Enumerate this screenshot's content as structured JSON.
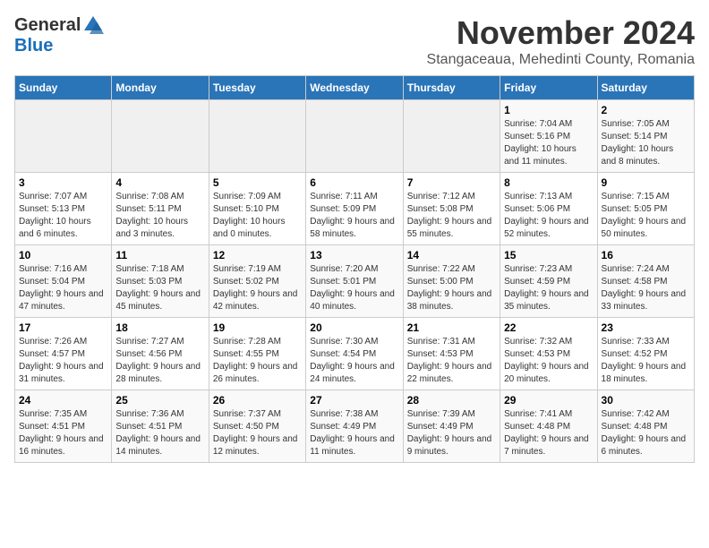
{
  "logo": {
    "general": "General",
    "blue": "Blue"
  },
  "title": {
    "month": "November 2024",
    "location": "Stangaceaua, Mehedinti County, Romania"
  },
  "weekdays": [
    "Sunday",
    "Monday",
    "Tuesday",
    "Wednesday",
    "Thursday",
    "Friday",
    "Saturday"
  ],
  "weeks": [
    [
      {
        "day": "",
        "info": ""
      },
      {
        "day": "",
        "info": ""
      },
      {
        "day": "",
        "info": ""
      },
      {
        "day": "",
        "info": ""
      },
      {
        "day": "",
        "info": ""
      },
      {
        "day": "1",
        "info": "Sunrise: 7:04 AM\nSunset: 5:16 PM\nDaylight: 10 hours and 11 minutes."
      },
      {
        "day": "2",
        "info": "Sunrise: 7:05 AM\nSunset: 5:14 PM\nDaylight: 10 hours and 8 minutes."
      }
    ],
    [
      {
        "day": "3",
        "info": "Sunrise: 7:07 AM\nSunset: 5:13 PM\nDaylight: 10 hours and 6 minutes."
      },
      {
        "day": "4",
        "info": "Sunrise: 7:08 AM\nSunset: 5:11 PM\nDaylight: 10 hours and 3 minutes."
      },
      {
        "day": "5",
        "info": "Sunrise: 7:09 AM\nSunset: 5:10 PM\nDaylight: 10 hours and 0 minutes."
      },
      {
        "day": "6",
        "info": "Sunrise: 7:11 AM\nSunset: 5:09 PM\nDaylight: 9 hours and 58 minutes."
      },
      {
        "day": "7",
        "info": "Sunrise: 7:12 AM\nSunset: 5:08 PM\nDaylight: 9 hours and 55 minutes."
      },
      {
        "day": "8",
        "info": "Sunrise: 7:13 AM\nSunset: 5:06 PM\nDaylight: 9 hours and 52 minutes."
      },
      {
        "day": "9",
        "info": "Sunrise: 7:15 AM\nSunset: 5:05 PM\nDaylight: 9 hours and 50 minutes."
      }
    ],
    [
      {
        "day": "10",
        "info": "Sunrise: 7:16 AM\nSunset: 5:04 PM\nDaylight: 9 hours and 47 minutes."
      },
      {
        "day": "11",
        "info": "Sunrise: 7:18 AM\nSunset: 5:03 PM\nDaylight: 9 hours and 45 minutes."
      },
      {
        "day": "12",
        "info": "Sunrise: 7:19 AM\nSunset: 5:02 PM\nDaylight: 9 hours and 42 minutes."
      },
      {
        "day": "13",
        "info": "Sunrise: 7:20 AM\nSunset: 5:01 PM\nDaylight: 9 hours and 40 minutes."
      },
      {
        "day": "14",
        "info": "Sunrise: 7:22 AM\nSunset: 5:00 PM\nDaylight: 9 hours and 38 minutes."
      },
      {
        "day": "15",
        "info": "Sunrise: 7:23 AM\nSunset: 4:59 PM\nDaylight: 9 hours and 35 minutes."
      },
      {
        "day": "16",
        "info": "Sunrise: 7:24 AM\nSunset: 4:58 PM\nDaylight: 9 hours and 33 minutes."
      }
    ],
    [
      {
        "day": "17",
        "info": "Sunrise: 7:26 AM\nSunset: 4:57 PM\nDaylight: 9 hours and 31 minutes."
      },
      {
        "day": "18",
        "info": "Sunrise: 7:27 AM\nSunset: 4:56 PM\nDaylight: 9 hours and 28 minutes."
      },
      {
        "day": "19",
        "info": "Sunrise: 7:28 AM\nSunset: 4:55 PM\nDaylight: 9 hours and 26 minutes."
      },
      {
        "day": "20",
        "info": "Sunrise: 7:30 AM\nSunset: 4:54 PM\nDaylight: 9 hours and 24 minutes."
      },
      {
        "day": "21",
        "info": "Sunrise: 7:31 AM\nSunset: 4:53 PM\nDaylight: 9 hours and 22 minutes."
      },
      {
        "day": "22",
        "info": "Sunrise: 7:32 AM\nSunset: 4:53 PM\nDaylight: 9 hours and 20 minutes."
      },
      {
        "day": "23",
        "info": "Sunrise: 7:33 AM\nSunset: 4:52 PM\nDaylight: 9 hours and 18 minutes."
      }
    ],
    [
      {
        "day": "24",
        "info": "Sunrise: 7:35 AM\nSunset: 4:51 PM\nDaylight: 9 hours and 16 minutes."
      },
      {
        "day": "25",
        "info": "Sunrise: 7:36 AM\nSunset: 4:51 PM\nDaylight: 9 hours and 14 minutes."
      },
      {
        "day": "26",
        "info": "Sunrise: 7:37 AM\nSunset: 4:50 PM\nDaylight: 9 hours and 12 minutes."
      },
      {
        "day": "27",
        "info": "Sunrise: 7:38 AM\nSunset: 4:49 PM\nDaylight: 9 hours and 11 minutes."
      },
      {
        "day": "28",
        "info": "Sunrise: 7:39 AM\nSunset: 4:49 PM\nDaylight: 9 hours and 9 minutes."
      },
      {
        "day": "29",
        "info": "Sunrise: 7:41 AM\nSunset: 4:48 PM\nDaylight: 9 hours and 7 minutes."
      },
      {
        "day": "30",
        "info": "Sunrise: 7:42 AM\nSunset: 4:48 PM\nDaylight: 9 hours and 6 minutes."
      }
    ]
  ]
}
